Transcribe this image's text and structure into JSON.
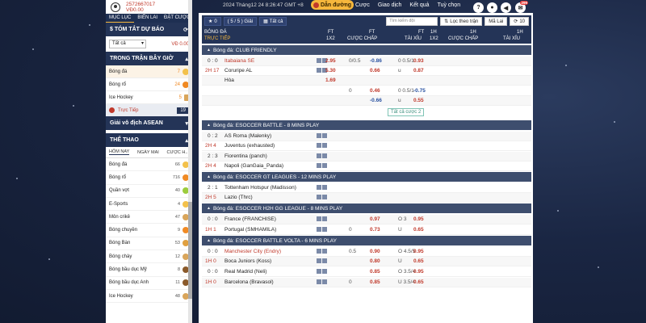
{
  "user": {
    "id": "2572667017",
    "balance": "VĐ0.00"
  },
  "left_tabs": [
    "MỤC LỤC",
    "BIẾN LAI",
    "ĐẶT CƯỢC"
  ],
  "summary": {
    "title": "$ TÓM TẮT DỰ BÁO",
    "filter": "Tất cả",
    "amount": "VĐ 0.00"
  },
  "live_section": {
    "title": "TRONG TRẬN BÂY GIỜ",
    "items": [
      {
        "name": "Bóng đá",
        "count": "7"
      },
      {
        "name": "Bóng rổ",
        "count": "24"
      },
      {
        "name": "Ice Hockey",
        "count": "5"
      }
    ],
    "live": {
      "label": "Trực Tiếp",
      "count": "19"
    }
  },
  "asean": "Giải vô địch ASEAN",
  "sports": {
    "title": "THỂ THAO",
    "tabs": [
      "HÔM NAY",
      "NGÀY MAI",
      "CƯỢC H..."
    ],
    "items": [
      {
        "name": "Bóng đá",
        "count": "66"
      },
      {
        "name": "Bóng rổ",
        "count": "716"
      },
      {
        "name": "Quần vợt",
        "count": "40"
      },
      {
        "name": "E-Sports",
        "count": "4"
      },
      {
        "name": "Môn crikê",
        "count": "47"
      },
      {
        "name": "Bóng chuyền",
        "count": "9"
      },
      {
        "name": "Bóng Bàn",
        "count": "53"
      },
      {
        "name": "Bóng chày",
        "count": "12"
      },
      {
        "name": "Bóng bầu dục Mỹ",
        "count": "8"
      },
      {
        "name": "Bóng bầu dục Anh",
        "count": "11"
      },
      {
        "name": "Ice Hockey",
        "count": "48"
      }
    ]
  },
  "header": {
    "datetime": "2024 Tháng12 24 8:26:47 GMT +8",
    "guide": "Dẫn đường",
    "links": [
      "Cược",
      "Giao dịch",
      "Kết quả",
      "Tuỳ chọn"
    ],
    "notif": "299"
  },
  "toolbar": {
    "star_count": "0",
    "match_count": "( 5 / 5 ) Giải",
    "all": "Tất cả",
    "search_placeholder": "Tìm kiếm đội",
    "filter": "Lọc theo trận",
    "refresh": "Mã Lai",
    "refresh_count": "10"
  },
  "columns": {
    "c1a": "BÓNG ĐÁ",
    "c1b": "TRỰC TIẾP",
    "ft": "FT",
    "x12": "1X2",
    "hcp": "CƯỢC CHẤP",
    "ou": "TÀI XỈU",
    "h1": "1H"
  },
  "leagues": [
    {
      "title": "Bóng đá: CLUB FRIENDLY"
    },
    {
      "title": "Bóng đá: ESOCCER BATTLE - 8 MINS PLAY"
    },
    {
      "title": "Bóng đá: ESOCCER GT LEAGUES - 12 MINS PLAY"
    },
    {
      "title": "Bóng đá: ESOCCER H2H GG LEAGUE - 8 MINS PLAY"
    },
    {
      "title": "Bóng đá: ESOCCER BATTLE VOLTA - 6 MINS PLAY"
    }
  ],
  "rows": [
    {
      "score": "0 : 0",
      "time": "",
      "team": "Itabaiana SE",
      "red": true,
      "o1": "2.95",
      "hc": "0/0.5",
      "hv": "-0.86",
      "ouL": "0 0.5/1",
      "ouV": "0.93"
    },
    {
      "score": "",
      "time": "2H 17",
      "team": "Coruripe AL",
      "red": false,
      "o1": "5.30",
      "hc": "",
      "hv": "0.66",
      "ouL": "u",
      "ouV": "0.87"
    },
    {
      "score": "",
      "time": "",
      "team": "Hòa",
      "red": false,
      "o1": "1.69",
      "hc": "",
      "hv": "",
      "ouL": "",
      "ouV": ""
    },
    {
      "score": "",
      "time": "",
      "team": "",
      "red": false,
      "o1": "",
      "hc": "0",
      "hv": "0.46",
      "ouL": "0 0.5/1",
      "ouV": "-0.75"
    },
    {
      "score": "",
      "time": "",
      "team": "",
      "red": false,
      "o1": "",
      "hc": "",
      "hv": "-0.66",
      "ouL": "u",
      "ouV": "0.55"
    },
    {
      "score": "0 : 2",
      "time": "",
      "team": "AS Roma (Malenky)",
      "red": false,
      "o1": "",
      "hc": "",
      "hv": "",
      "ouL": "",
      "ouV": ""
    },
    {
      "score": "",
      "time": "2H 4",
      "team": "Juventus (exhausted)",
      "red": false,
      "o1": "",
      "hc": "",
      "hv": "",
      "ouL": "",
      "ouV": ""
    },
    {
      "score": "2 : 3",
      "time": "",
      "team": "Fiorentina (panch)",
      "red": false,
      "o1": "",
      "hc": "",
      "hv": "",
      "ouL": "",
      "ouV": ""
    },
    {
      "score": "",
      "time": "2H 4",
      "team": "Napoli (GanGaia_Panda)",
      "red": false,
      "o1": "",
      "hc": "",
      "hv": "",
      "ouL": "",
      "ouV": ""
    },
    {
      "score": "2 : 1",
      "time": "",
      "team": "Tottenham Hotspur (Madisson)",
      "red": false,
      "o1": "",
      "hc": "",
      "hv": "",
      "ouL": "",
      "ouV": ""
    },
    {
      "score": "",
      "time": "2H 5",
      "team": "Lazio (Thrc)",
      "red": false,
      "o1": "",
      "hc": "",
      "hv": "",
      "ouL": "",
      "ouV": ""
    },
    {
      "score": "0 : 0",
      "time": "",
      "team": "France (FRANCHISE)",
      "red": false,
      "o1": "",
      "hc": "",
      "hv": "0.97",
      "ouL": "O 3",
      "ouV": "0.95"
    },
    {
      "score": "",
      "time": "1H 1",
      "team": "Portugal (SMHAMILA)",
      "red": false,
      "o1": "",
      "hc": "0",
      "hv": "0.73",
      "ouL": "U",
      "ouV": "0.65"
    },
    {
      "score": "0 : 0",
      "time": "",
      "team": "Manchester City (Endry)",
      "red": true,
      "o1": "",
      "hc": "0.5",
      "hv": "0.90",
      "ouL": "O 4.5/5",
      "ouV": "0.95"
    },
    {
      "score": "",
      "time": "1H 0",
      "team": "Boca Juniors (Koss)",
      "red": false,
      "o1": "",
      "hc": "",
      "hv": "0.80",
      "ouL": "U",
      "ouV": "0.65"
    },
    {
      "score": "0 : 0",
      "time": "",
      "team": "Real Madrid (Neli)",
      "red": false,
      "o1": "",
      "hc": "",
      "hv": "0.85",
      "ouL": "O 3.5/4",
      "ouV": "0.95"
    },
    {
      "score": "",
      "time": "1H 0",
      "team": "Barcelona (Bravasol)",
      "red": false,
      "o1": "",
      "hc": "0",
      "hv": "0.85",
      "ouL": "U 3.5/4",
      "ouV": "0.65"
    }
  ],
  "more_bets": "Tất cả cược 2"
}
